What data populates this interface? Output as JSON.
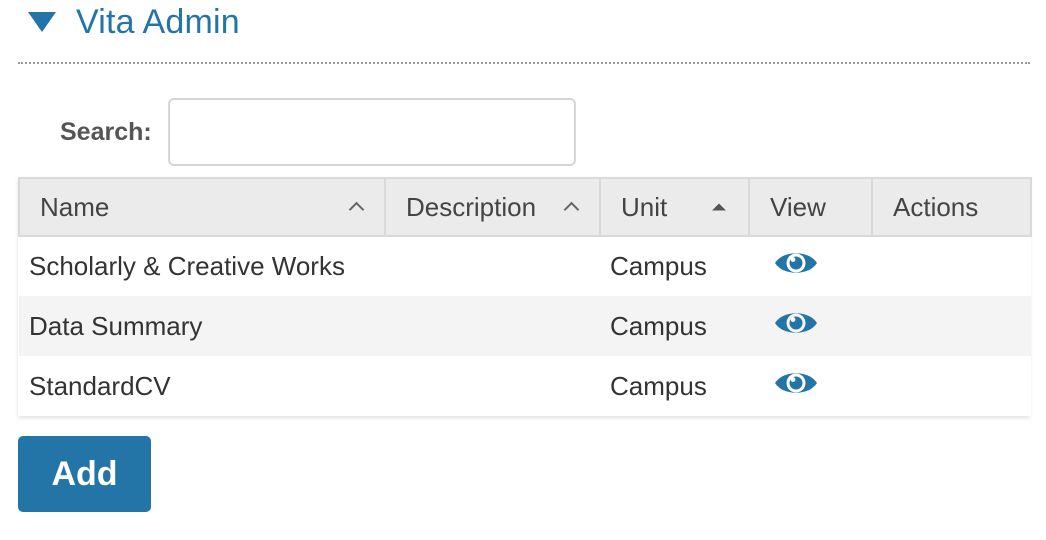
{
  "section": {
    "title": "Vita Admin"
  },
  "search": {
    "label": "Search:",
    "value": "",
    "placeholder": ""
  },
  "table": {
    "columns": [
      {
        "label": "Name",
        "sort": "ascending-indicator"
      },
      {
        "label": "Description",
        "sort": "ascending-indicator"
      },
      {
        "label": "Unit",
        "sort": "ascending-active"
      },
      {
        "label": "View",
        "sort": "none"
      },
      {
        "label": "Actions",
        "sort": "none"
      }
    ],
    "rows": [
      {
        "name": "Scholarly & Creative Works",
        "description": "",
        "unit": "Campus",
        "view_icon": "eye-icon"
      },
      {
        "name": "Data Summary",
        "description": "",
        "unit": "Campus",
        "view_icon": "eye-icon"
      },
      {
        "name": "StandardCV",
        "description": "",
        "unit": "Campus",
        "view_icon": "eye-icon"
      }
    ]
  },
  "actions": {
    "add_label": "Add"
  },
  "colors": {
    "accent": "#2475a7",
    "header_bg": "#ebebeb",
    "row_alt_bg": "#f4f4f4"
  }
}
